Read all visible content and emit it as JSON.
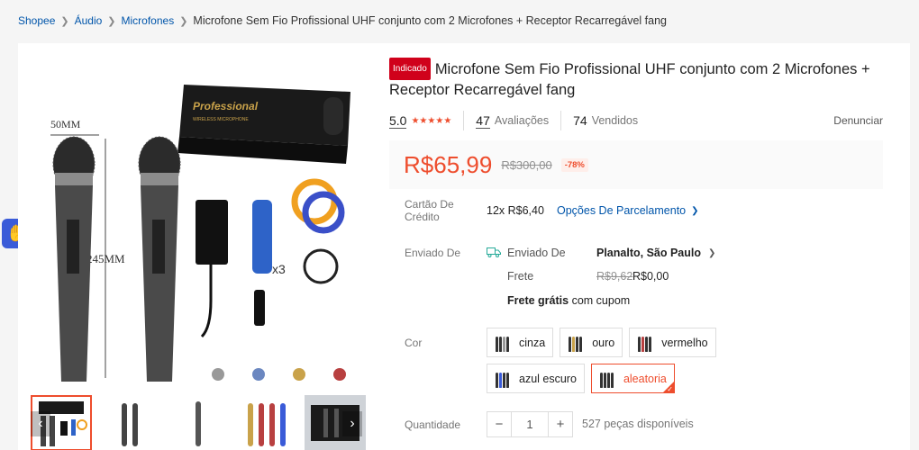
{
  "breadcrumb": {
    "items": [
      "Shopee",
      "Áudio",
      "Microfones"
    ],
    "current": "Microfone Sem Fio Profissional UHF conjunto com 2 Microfones + Receptor Recarregável fang"
  },
  "gallery": {
    "box_brand": "Professional",
    "box_subtitle": "WIRELESS MICROPHONE",
    "dim_width": "50MM",
    "dim_height": "245MM",
    "battery_count": "x3",
    "thumb_count": 5,
    "active_thumb": 0
  },
  "product": {
    "badge": "Indicado",
    "title": "Microfone Sem Fio Profissional UHF conjunto com 2 Microfones + Receptor Recarregável fang",
    "rating": "5.0",
    "stars": "★★★★★",
    "reviews_count": "47",
    "reviews_label": "Avaliações",
    "sold_count": "74",
    "sold_label": "Vendidos",
    "report_label": "Denunciar"
  },
  "price": {
    "current": "R$65,99",
    "original": "R$300,00",
    "discount": "-78%"
  },
  "installments": {
    "label": "Cartão De Crédito",
    "value": "12x R$6,40",
    "link": "Opções De Parcelamento"
  },
  "shipping": {
    "label": "Enviado De",
    "from_label": "Enviado De",
    "from_value": "Planalto, São Paulo",
    "freight_label": "Frete",
    "freight_old": "R$9,62",
    "freight_new": "R$0,00",
    "free_strong": "Frete grátis",
    "free_rest": "com cupom"
  },
  "variations": {
    "label": "Cor",
    "options": [
      "cinza",
      "ouro",
      "vermelho",
      "azul escuro",
      "aleatoria"
    ],
    "selected": "aleatoria"
  },
  "quantity": {
    "label": "Quantidade",
    "minus": "−",
    "value": "1",
    "plus": "+",
    "available": "527 peças disponíveis"
  },
  "colors": {
    "accent": "#ee4d2d",
    "link": "#05a",
    "badge": "#d0011b",
    "access": "#3a5bd8"
  }
}
